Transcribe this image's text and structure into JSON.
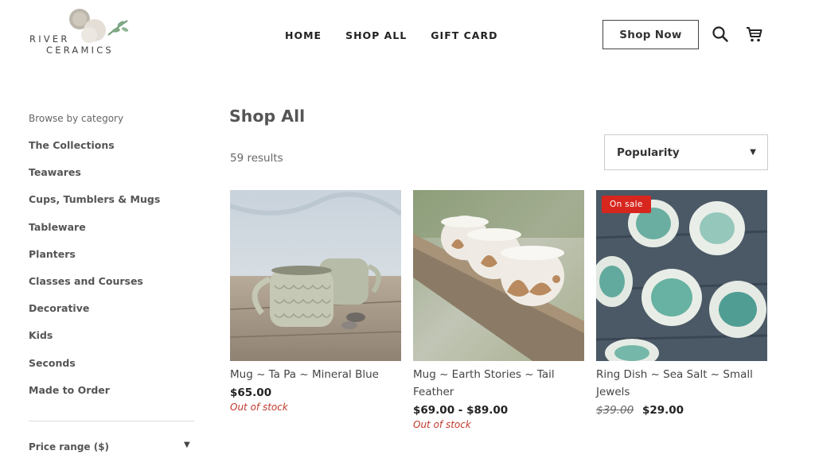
{
  "brand": {
    "line1": "RIVER",
    "line2": "CERAMICS"
  },
  "nav": {
    "items": [
      "HOME",
      "SHOP ALL",
      "GIFT CARD"
    ]
  },
  "header": {
    "cta_label": "Shop Now",
    "search_icon": "search-icon",
    "cart_icon": "cart-icon"
  },
  "sidebar": {
    "title": "Browse by category",
    "categories": [
      "The Collections",
      "Teawares",
      "Cups, Tumblers & Mugs",
      "Tableware",
      "Planters",
      "Classes and Courses",
      "Decorative",
      "Kids",
      "Seconds",
      "Made to Order"
    ],
    "price_filter_label": "Price range ($)"
  },
  "main": {
    "title": "Shop All",
    "results_text": "59 results",
    "sort_selected": "Popularity"
  },
  "products": [
    {
      "name": "Mug ~ Ta Pa ~ Mineral Blue",
      "price": "$65.00",
      "stock": "Out of stock"
    },
    {
      "name": "Mug ~ Earth Stories ~ Tail Feather",
      "price": "$69.00 - $89.00",
      "stock": "Out of stock"
    },
    {
      "name": "Ring Dish ~ Sea Salt ~ Small Jewels",
      "badge": "On sale",
      "old_price": "$39.00",
      "price": "$29.00"
    }
  ],
  "colors": {
    "sale_badge": "#d7261e",
    "out_of_stock": "#c0392b"
  }
}
